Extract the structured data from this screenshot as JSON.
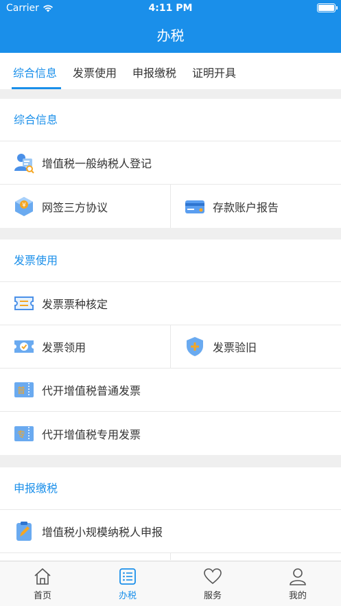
{
  "status_bar": {
    "carrier": "Carrier",
    "time": "4:11 PM"
  },
  "nav": {
    "title": "办税"
  },
  "tabs": [
    {
      "label": "综合信息",
      "active": true
    },
    {
      "label": "发票使用",
      "active": false
    },
    {
      "label": "申报缴税",
      "active": false
    },
    {
      "label": "证明开具",
      "active": false
    }
  ],
  "sections": {
    "general": {
      "title": "综合信息",
      "items": {
        "vat_register": "增值税一般纳税人登记",
        "tripartite": "网签三方协议",
        "deposit_report": "存款账户报告"
      }
    },
    "invoice": {
      "title": "发票使用",
      "items": {
        "verify_type": "发票票种核定",
        "receive": "发票领用",
        "check_old": "发票验旧",
        "agent_normal": "代开增值税普通发票",
        "agent_special": "代开增值税专用发票"
      }
    },
    "declare": {
      "title": "申报缴税",
      "items": {
        "small_scale": "增值税小规模纳税人申报"
      }
    }
  },
  "tabbar": [
    {
      "label": "首页",
      "icon": "home-icon",
      "active": false
    },
    {
      "label": "办税",
      "icon": "list-icon",
      "active": true
    },
    {
      "label": "服务",
      "icon": "heart-icon",
      "active": false
    },
    {
      "label": "我的",
      "icon": "person-icon",
      "active": false
    }
  ],
  "colors": {
    "accent": "#1a8fea",
    "background": "#efefef",
    "divider": "#e8e8e8"
  }
}
